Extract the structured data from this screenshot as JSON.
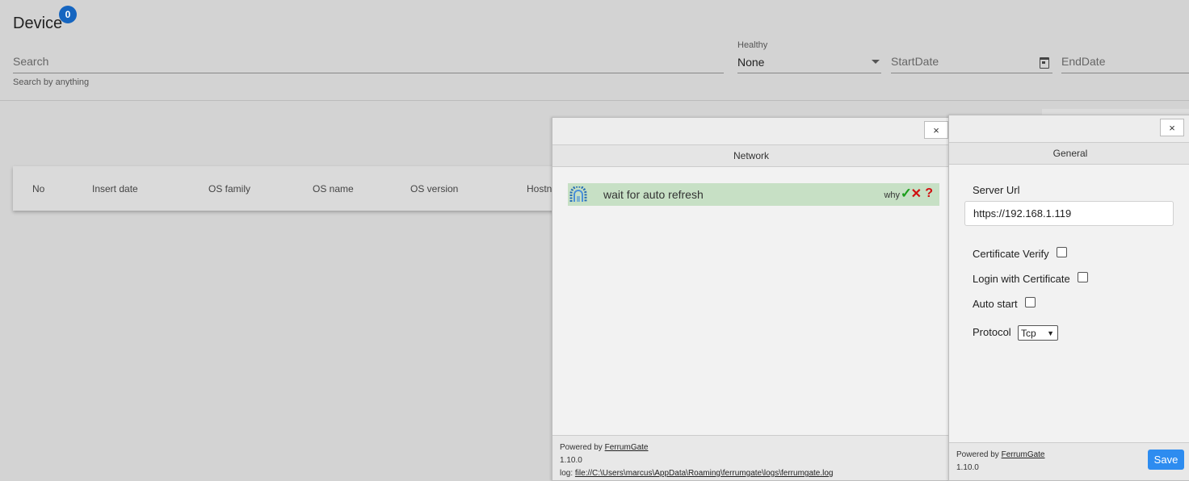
{
  "page": {
    "title": "Device",
    "badge_count": "0"
  },
  "filters": {
    "search_placeholder": "Search",
    "search_hint": "Search by anything",
    "healthy_label": "Healthy",
    "healthy_value": "None",
    "start_placeholder": "StartDate",
    "end_placeholder": "EndDate"
  },
  "table": {
    "columns": [
      "No",
      "Insert date",
      "OS family",
      "OS name",
      "OS version",
      "Hostn"
    ]
  },
  "network_window": {
    "close_label": "×",
    "section_title": "Network",
    "status_text": "wait for auto refresh",
    "why_label": "why",
    "check_glyph": "✓",
    "cross_glyph": "✕",
    "question_glyph": "?",
    "powered_by": "Powered by",
    "brand_link": "FerrumGate",
    "version": "1.10.0",
    "log_prefix": "log:",
    "log_path": "file://C:\\Users\\marcus\\AppData\\Roaming\\ferrumgate\\logs\\ferrumgate.log"
  },
  "general_window": {
    "close_label": "×",
    "section_title": "General",
    "server_url_label": "Server Url",
    "server_url_value": "https://192.168.1.119",
    "cert_verify_label": "Certificate Verify",
    "login_cert_label": "Login with Certificate",
    "auto_start_label": "Auto start",
    "protocol_label": "Protocol",
    "protocol_value": "Tcp",
    "powered_by": "Powered by",
    "brand_link": "FerrumGate",
    "version": "1.10.0",
    "save_label": "Save"
  },
  "colors": {
    "badge": "#1565c0",
    "status_row": "#c7e0c5",
    "save_button": "#2d8cf0",
    "check": "#1b9e1b",
    "cross": "#d01010"
  }
}
